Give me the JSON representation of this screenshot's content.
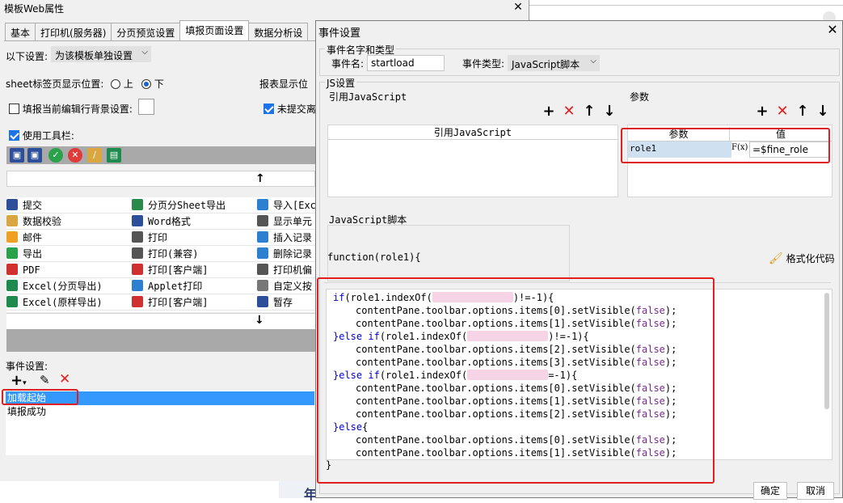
{
  "left_window": {
    "title": "模板Web属性",
    "tabs": [
      "基本",
      "打印机(服务器)",
      "分页预览设置",
      "填报页面设置",
      "数据分析设"
    ],
    "active_tab": "填报页面设置",
    "settings_label": "以下设置:",
    "settings_select": "为该模板单独设置",
    "sheet_tab_label": "sheet标签页显示位置:",
    "radio_top": "上",
    "radio_bottom": "下",
    "report_display_label": "报表显示位",
    "fill_bg_label": "填报当前编辑行背景设置:",
    "no_submit_label": "未提交离",
    "use_toolbar_label": "使用工具栏:",
    "toolbar_items": [
      [
        "提交",
        "分页分Sheet导出",
        "导入[Exc"
      ],
      [
        "数据校验",
        "Word格式",
        "显示单元"
      ],
      [
        "邮件",
        "打印",
        "插入记录"
      ],
      [
        "导出",
        "打印(兼容)",
        "删除记录"
      ],
      [
        "PDF",
        "打印[客户端]",
        "打印机偏"
      ],
      [
        "Excel(分页导出)",
        "Applet打印",
        "自定义按"
      ],
      [
        "Excel(原样导出)",
        "打印[客户端]",
        "暂存"
      ]
    ],
    "event_settings_label": "事件设置:",
    "events": [
      "加载起始",
      "填报成功"
    ],
    "selected_event": "加载起始"
  },
  "dialog": {
    "title": "事件设置",
    "event_group_title": "事件名字和类型",
    "event_name_label": "事件名:",
    "event_name_value": "startload",
    "event_type_label": "事件类型:",
    "event_type_value": "JavaScript脚本",
    "js_group_title": "JS设置",
    "ref_js_label": "引用JavaScript",
    "ref_js_column": "引用JavaScript",
    "params_label": "参数",
    "params_col_param": "参数",
    "params_col_value": "值",
    "param_name": "role1",
    "param_formula_icon": "F(x)",
    "param_value": "=$fine_role",
    "script_label": "JavaScript脚本",
    "function_signature": "function(role1){",
    "format_code_label": "格式化代码",
    "closing_brace": "}",
    "ok_button": "确定",
    "cancel_button": "取消"
  },
  "background_app": {
    "bottom_text": "年"
  },
  "code_lines": [
    {
      "indent": 0,
      "pre_kw": "",
      "kw": "if",
      "text": "(role1.indexOf(",
      "blur": true,
      "after": ")!=-1){"
    },
    {
      "indent": 2,
      "pre_kw": "",
      "kw": "",
      "text": "contentPane.toolbar.options.items[0].setVisible(",
      "bool": "false",
      "after": ");"
    },
    {
      "indent": 2,
      "pre_kw": "",
      "kw": "",
      "text": "contentPane.toolbar.options.items[1].setVisible(",
      "bool": "false",
      "after": ");"
    },
    {
      "indent": 0,
      "pre_kw": "}",
      "kw": "else if",
      "text": "(role1.indexOf(",
      "blur": true,
      "after": ")!=-1){"
    },
    {
      "indent": 2,
      "pre_kw": "",
      "kw": "",
      "text": "contentPane.toolbar.options.items[2].setVisible(",
      "bool": "false",
      "after": ");"
    },
    {
      "indent": 2,
      "pre_kw": "",
      "kw": "",
      "text": "contentPane.toolbar.options.items[3].setVisible(",
      "bool": "false",
      "after": ");"
    },
    {
      "indent": 0,
      "pre_kw": "}",
      "kw": "else if",
      "text": "(role1.indexOf(",
      "blur": true,
      "after": "=-1){"
    },
    {
      "indent": 2,
      "pre_kw": "",
      "kw": "",
      "text": "contentPane.toolbar.options.items[0].setVisible(",
      "bool": "false",
      "after": ");"
    },
    {
      "indent": 2,
      "pre_kw": "",
      "kw": "",
      "text": "contentPane.toolbar.options.items[1].setVisible(",
      "bool": "false",
      "after": ");"
    },
    {
      "indent": 2,
      "pre_kw": "",
      "kw": "",
      "text": "contentPane.toolbar.options.items[2].setVisible(",
      "bool": "false",
      "after": ");"
    },
    {
      "indent": 0,
      "pre_kw": "}",
      "kw": "else",
      "text": "{",
      "after": ""
    },
    {
      "indent": 2,
      "pre_kw": "",
      "kw": "",
      "text": "contentPane.toolbar.options.items[0].setVisible(",
      "bool": "false",
      "after": ");"
    },
    {
      "indent": 2,
      "pre_kw": "",
      "kw": "",
      "text": "contentPane.toolbar.options.items[1].setVisible(",
      "bool": "false",
      "after": ");"
    }
  ],
  "colors": {
    "highlight_red": "#e02020",
    "selection_blue": "#3399ff",
    "keyword_blue": "#0000cc",
    "literal_purple": "#7b2a8f"
  }
}
